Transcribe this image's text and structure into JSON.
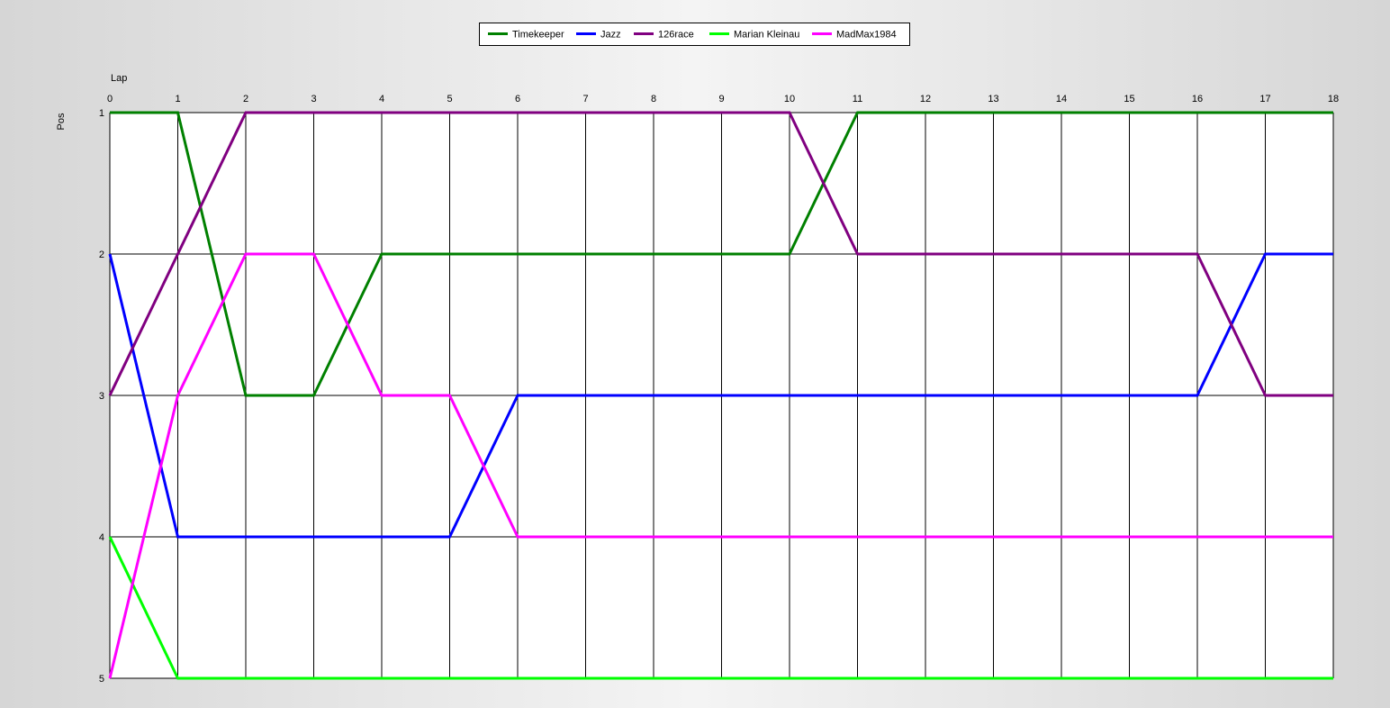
{
  "chart_data": {
    "type": "line",
    "xlabel": "Lap",
    "ylabel": "Pos",
    "x": [
      0,
      1,
      2,
      3,
      4,
      5,
      6,
      7,
      8,
      9,
      10,
      11,
      12,
      13,
      14,
      15,
      16,
      17,
      18
    ],
    "xlim": [
      0,
      18
    ],
    "ylim": [
      1,
      5
    ],
    "y_inverted": true,
    "y_ticks": [
      1,
      2,
      3,
      4,
      5
    ],
    "grid": true,
    "legend_position": "top-center",
    "series": [
      {
        "name": "Timekeeper",
        "color": "#008000",
        "values": [
          1,
          1,
          3,
          3,
          2,
          2,
          2,
          2,
          2,
          2,
          2,
          1,
          1,
          1,
          1,
          1,
          1,
          1,
          1
        ]
      },
      {
        "name": "Jazz",
        "color": "#0000ff",
        "values": [
          2,
          4,
          4,
          4,
          4,
          4,
          3,
          3,
          3,
          3,
          3,
          3,
          3,
          3,
          3,
          3,
          3,
          2,
          2
        ]
      },
      {
        "name": "126race",
        "color": "#800080",
        "values": [
          3,
          2,
          1,
          1,
          1,
          1,
          1,
          1,
          1,
          1,
          1,
          2,
          2,
          2,
          2,
          2,
          2,
          3,
          3
        ]
      },
      {
        "name": "Marian Kleinau",
        "color": "#00ff00",
        "values": [
          4,
          5,
          5,
          5,
          5,
          5,
          5,
          5,
          5,
          5,
          5,
          5,
          5,
          5,
          5,
          5,
          5,
          5,
          5
        ]
      },
      {
        "name": "MadMax1984",
        "color": "#ff00ff",
        "values": [
          5,
          3,
          2,
          2,
          3,
          3,
          4,
          4,
          4,
          4,
          4,
          4,
          4,
          4,
          4,
          4,
          4,
          4,
          4
        ]
      }
    ]
  }
}
